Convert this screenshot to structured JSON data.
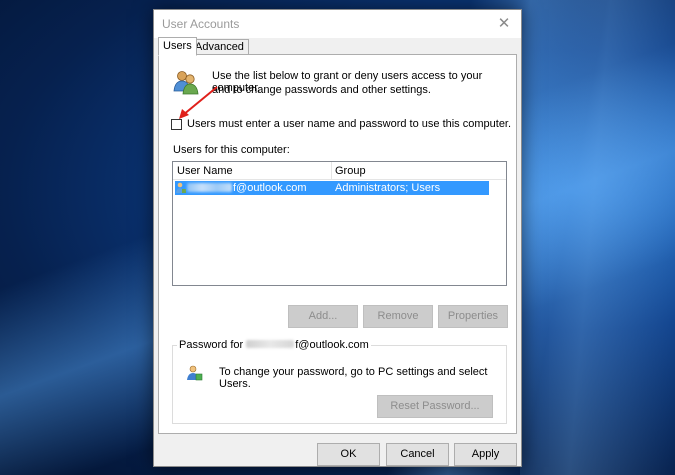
{
  "window": {
    "title": "User Accounts",
    "close_glyph": "✕"
  },
  "tabs": [
    {
      "label": "Users",
      "active": true
    },
    {
      "label": "Advanced",
      "active": false
    }
  ],
  "users_tab": {
    "intro_line1": "Use the list below to grant or deny users access to your computer,",
    "intro_line2": "and to change passwords and other settings.",
    "require_login_label": "Users must enter a user name and password to use this computer.",
    "require_login_checked": false,
    "users_list_label": "Users for this computer:",
    "columns": [
      "User Name",
      "Group"
    ],
    "rows": [
      {
        "username_visible": "f@outlook.com",
        "group": "Administrators; Users",
        "selected": true
      }
    ],
    "buttons": {
      "add": "Add...",
      "remove": "Remove",
      "properties": "Properties"
    },
    "password_group": {
      "title_prefix": "Password for ",
      "title_suffix": "f@outlook.com",
      "message": "To change your password, go to PC settings and select Users.",
      "reset_button": "Reset Password..."
    }
  },
  "footer": {
    "ok": "OK",
    "cancel": "Cancel",
    "apply": "Apply"
  },
  "colors": {
    "selection": "#3399ff",
    "annotation_arrow": "#e0201b",
    "title_text": "#9a9a9a"
  },
  "icons": [
    "users-icon",
    "user-row-icon",
    "password-user-icon",
    "close-icon",
    "red-arrow-annotation"
  ]
}
